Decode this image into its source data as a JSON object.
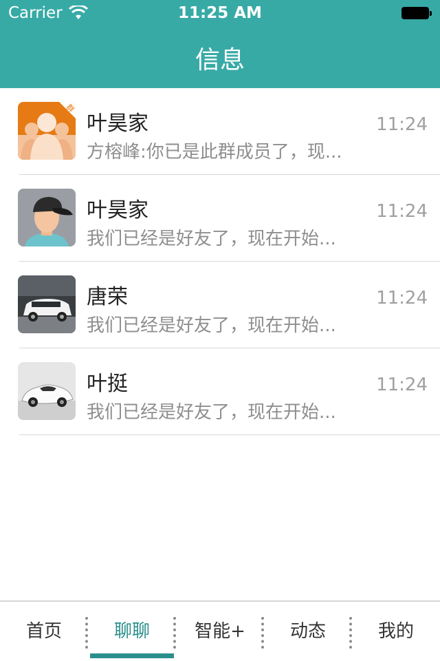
{
  "status_bar": {
    "carrier": "Carrier",
    "time": "11:25 AM"
  },
  "nav": {
    "title": "信息"
  },
  "colors": {
    "accent": "#38aaa6",
    "tab_active": "#2a8f8c"
  },
  "conversations": [
    {
      "name": "叶昊家",
      "message": "方榕峰:你已是此群成员了，现...",
      "time": "11:24",
      "avatar": "group-avatar-icon",
      "badge": "群"
    },
    {
      "name": "叶昊家",
      "message": "我们已经是好友了，现在开始...",
      "time": "11:24",
      "avatar": "user-cap-avatar"
    },
    {
      "name": "唐荣",
      "message": "我们已经是好友了，现在开始...",
      "time": "11:24",
      "avatar": "white-suv-avatar"
    },
    {
      "name": "叶挺",
      "message": "我们已经是好友了，现在开始...",
      "time": "11:24",
      "avatar": "white-sportscar-avatar"
    }
  ],
  "tabs": [
    {
      "label": "首页",
      "active": false
    },
    {
      "label": "聊聊",
      "active": true
    },
    {
      "label": "智能+",
      "active": false
    },
    {
      "label": "动态",
      "active": false
    },
    {
      "label": "我的",
      "active": false
    }
  ]
}
